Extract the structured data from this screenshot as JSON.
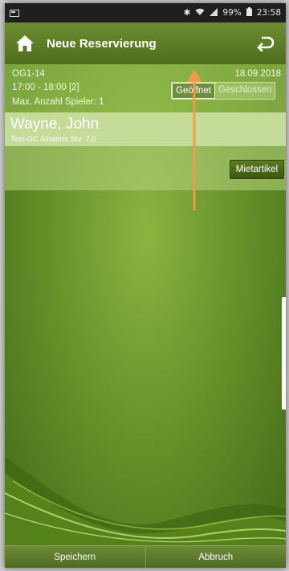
{
  "status_bar": {
    "battery": "99%",
    "time": "23:58"
  },
  "header": {
    "title": "Neue Reservierung"
  },
  "reservation": {
    "course": "OG1-14",
    "date": "18.09.2018",
    "time_slot": "17:00 - 18:00 [2]",
    "max_players": "Max. Anzahl Spieler: 1",
    "toggle": {
      "open_label": "Geöffnet",
      "closed_label": "Geschlossen",
      "selected": "Geöffnet"
    }
  },
  "player": {
    "name": "Wayne, John",
    "club": "Test-GC Albatros Stv: 7,0"
  },
  "rental": {
    "button_label": "Mietartikel"
  },
  "footer": {
    "save_label": "Speichern",
    "cancel_label": "Abbruch"
  },
  "colors": {
    "accent_arrow": "#f39a4a",
    "brand_green": "#4e6d1c"
  }
}
